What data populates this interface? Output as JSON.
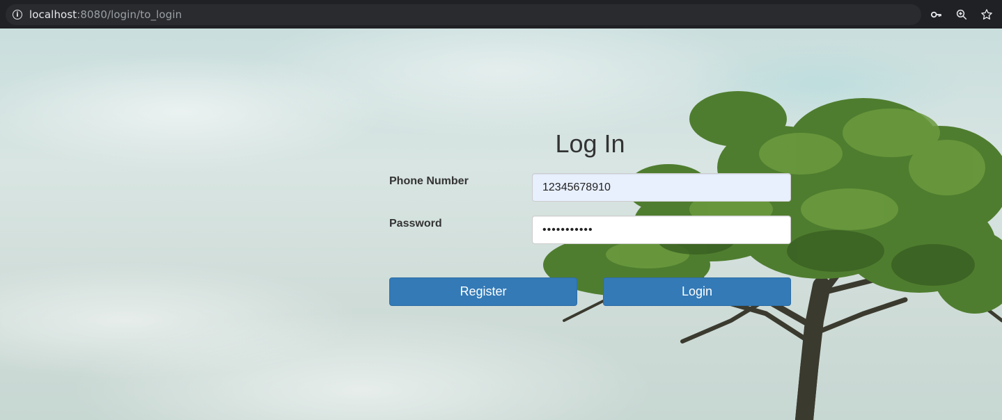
{
  "browser": {
    "url_host": "localhost",
    "url_rest": ":8080/login/to_login",
    "icons": [
      "info-icon",
      "key-icon",
      "zoom-icon",
      "star-icon"
    ]
  },
  "form": {
    "title": "Log In",
    "phone_label": "Phone Number",
    "phone_value": "12345678910",
    "password_label": "Password",
    "password_value": "•••••••••••",
    "register_label": "Register",
    "login_label": "Login"
  },
  "colors": {
    "button": "#337ab7",
    "autofill": "#e8f0fe",
    "browser_bar": "#202124"
  }
}
